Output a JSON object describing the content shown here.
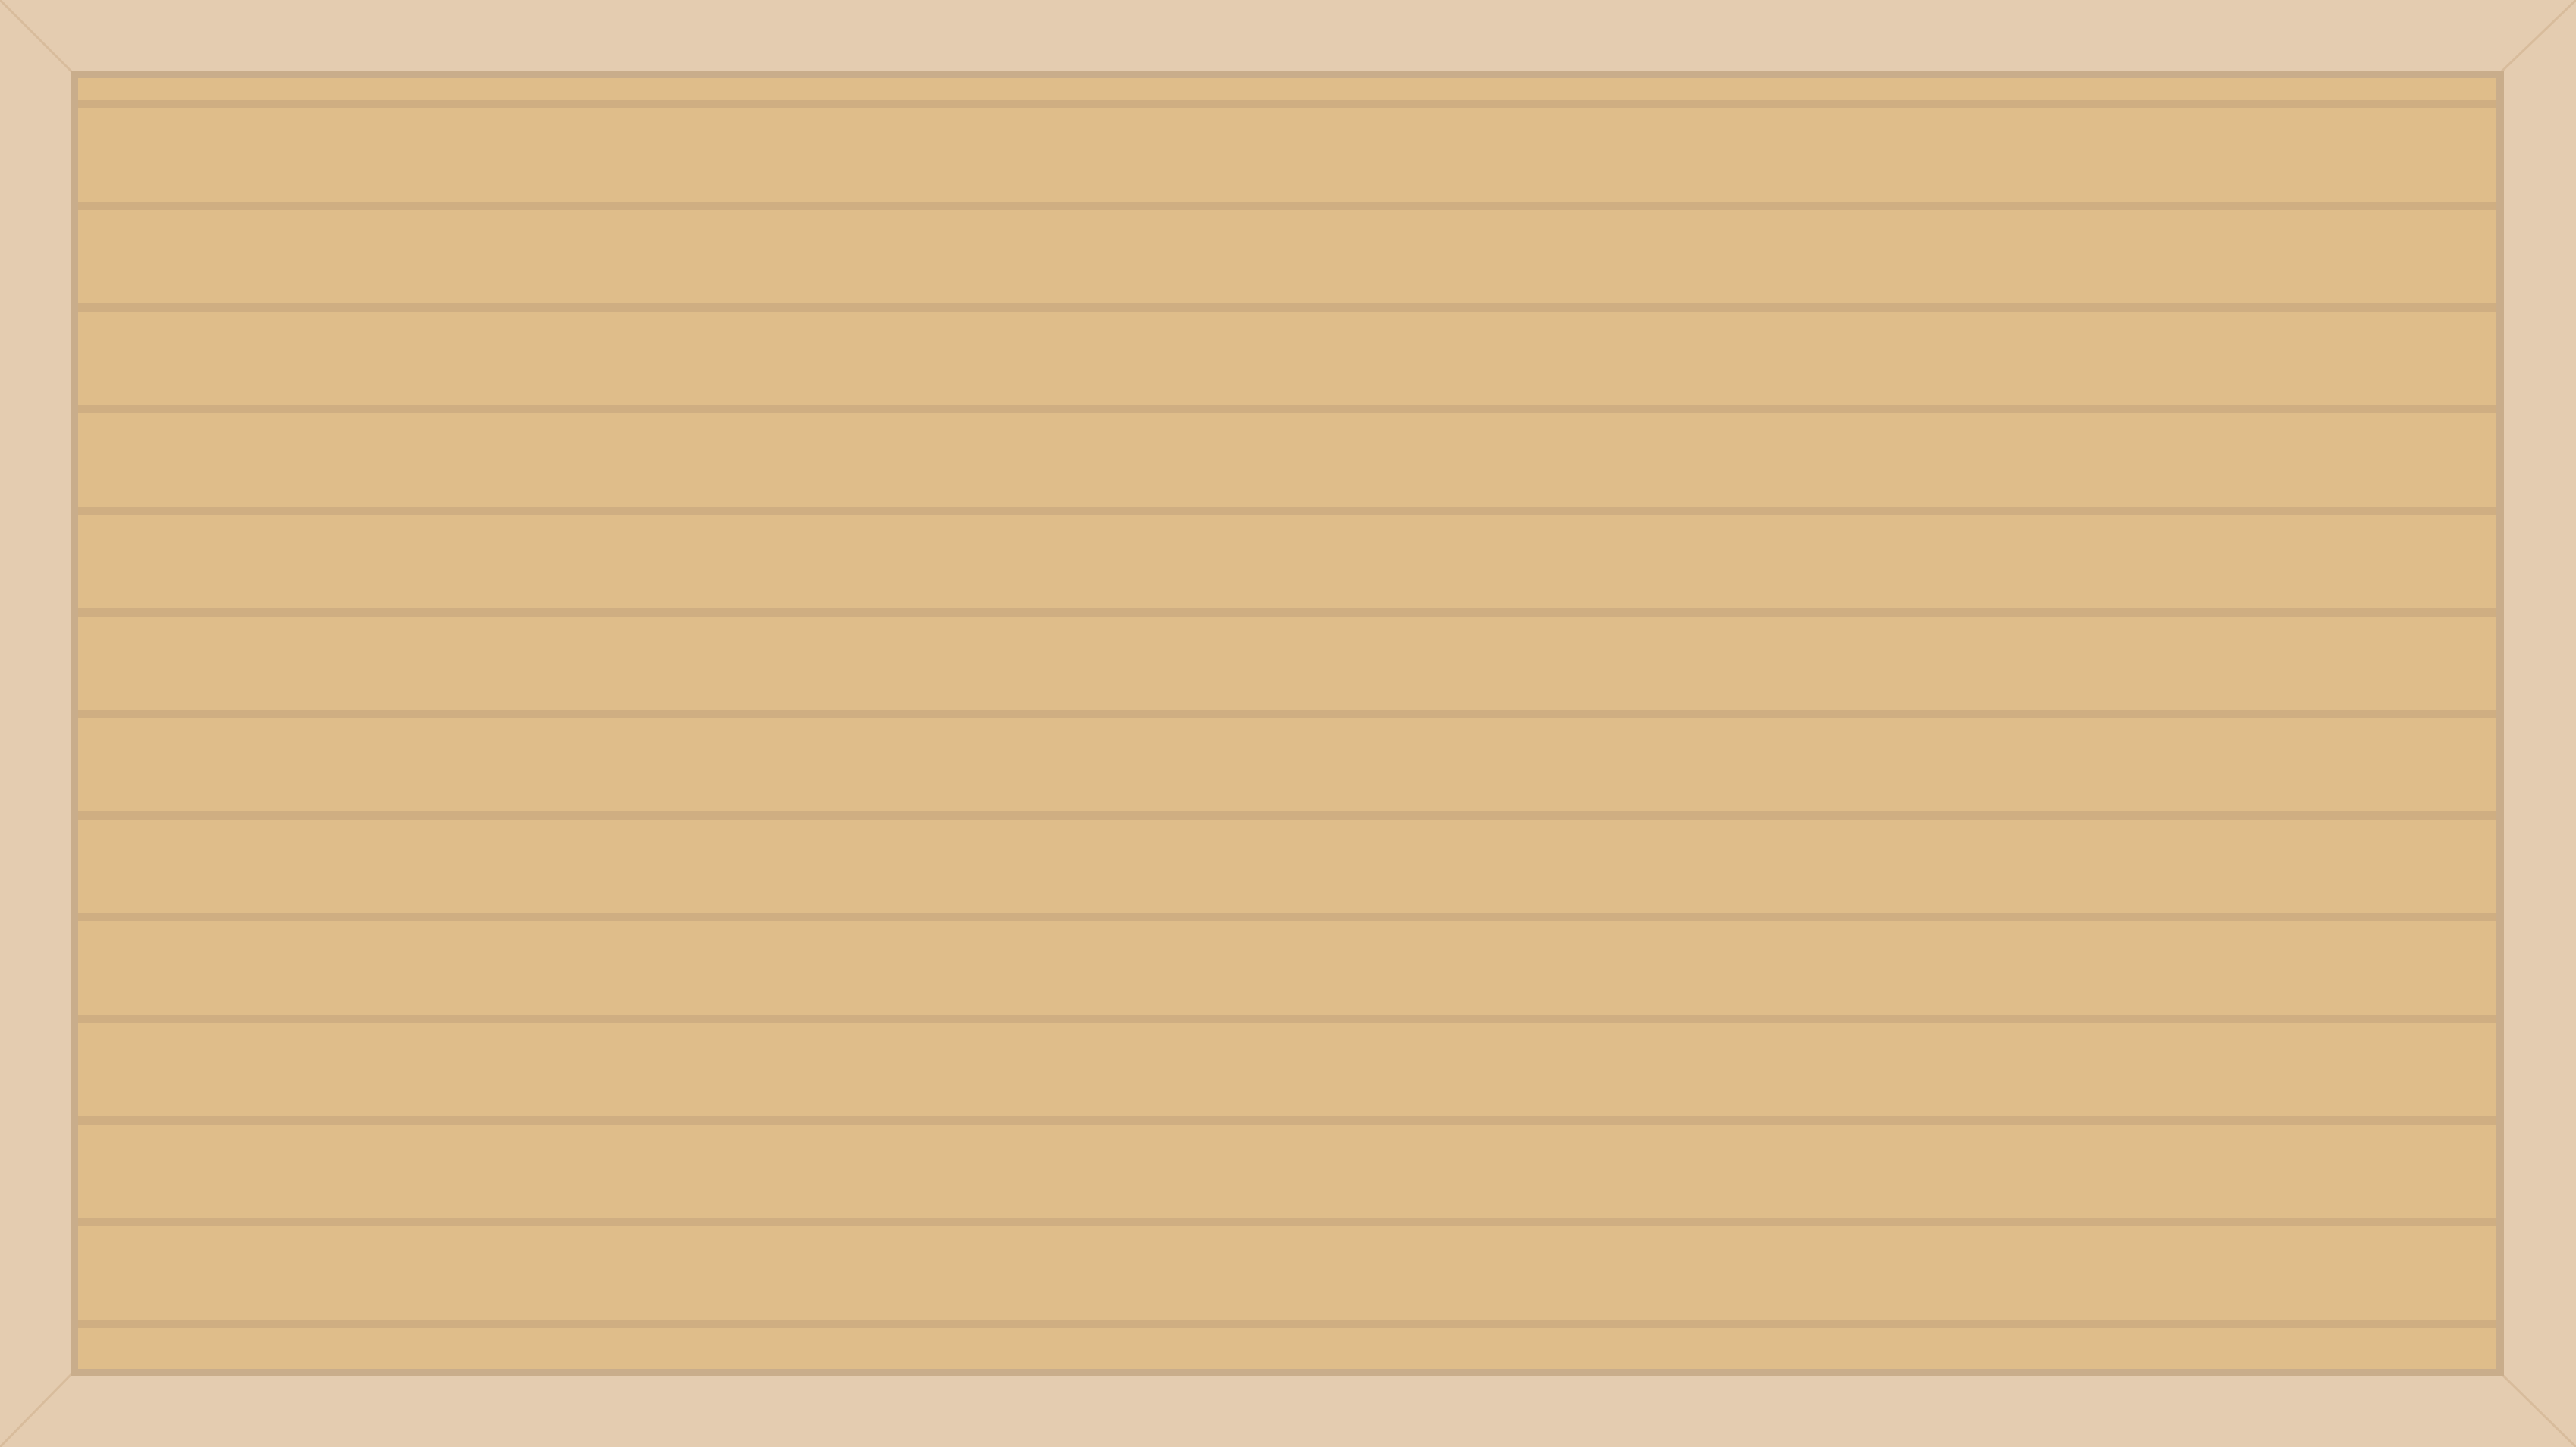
{
  "frame": {
    "colors": {
      "frame": "#e4ccb0",
      "frame_edge": "#d8bc9c",
      "board": "#dfbd8a",
      "line": "#cfae82",
      "border": "#c9ad8b"
    },
    "line_count": 13
  }
}
